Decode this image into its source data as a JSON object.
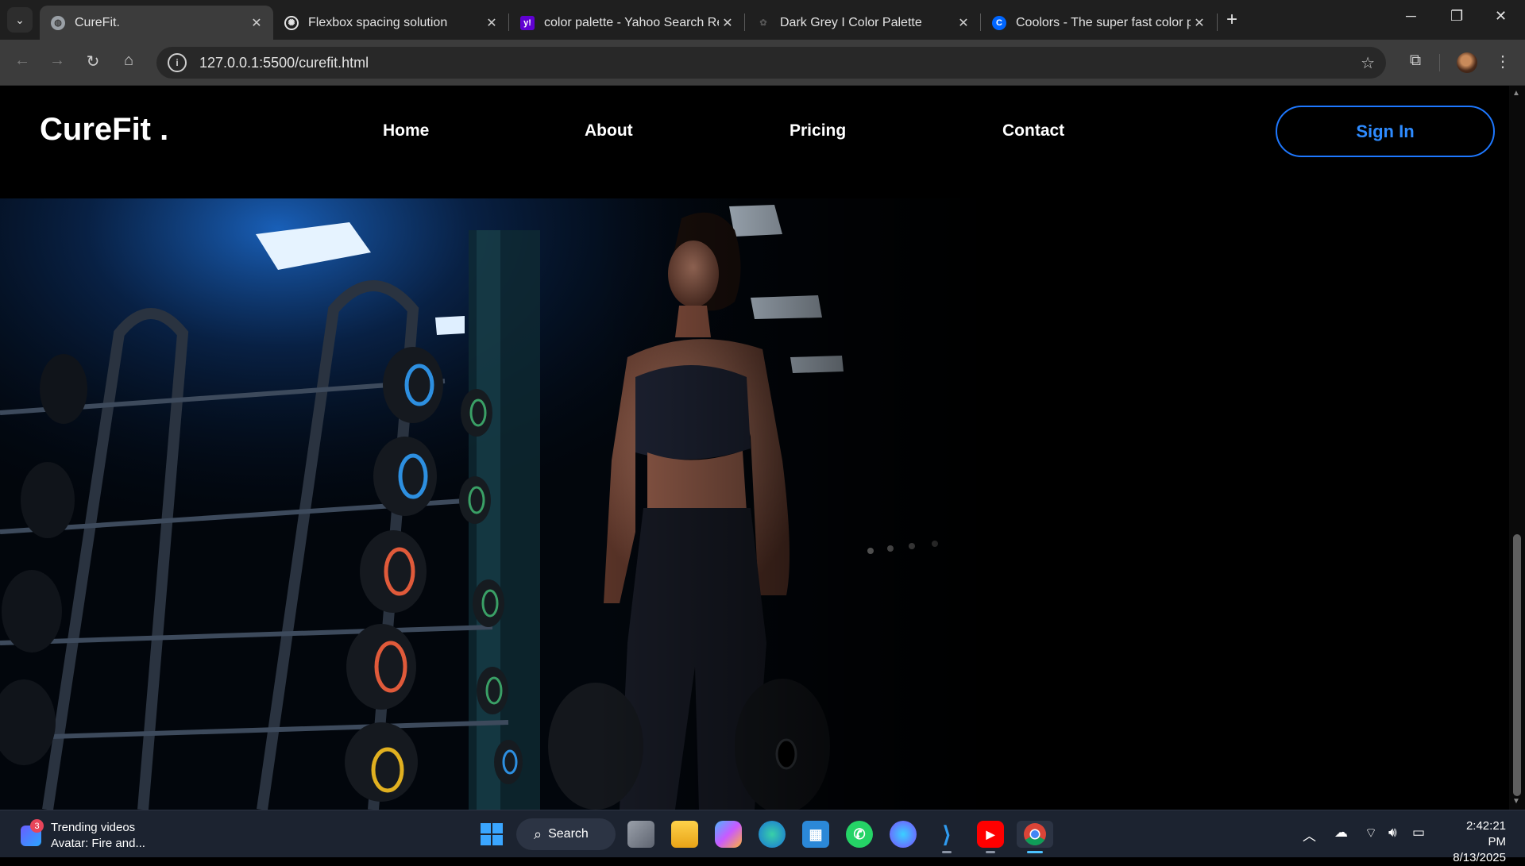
{
  "browser": {
    "tabs": [
      {
        "title": "CureFit.",
        "active": true,
        "icon": "globe-icon"
      },
      {
        "title": "Flexbox spacing solution",
        "active": false,
        "icon": "chatgpt-icon"
      },
      {
        "title": "color palette - Yahoo Search Re",
        "active": false,
        "icon": "yahoo-icon"
      },
      {
        "title": "Dark Grey I Color Palette",
        "active": false,
        "icon": "palette-icon"
      },
      {
        "title": "Coolors - The super fast color p",
        "active": false,
        "icon": "coolors-icon"
      }
    ],
    "url": "127.0.0.1:5500/curefit.html"
  },
  "site": {
    "logo": "CureFit .",
    "nav": [
      "Home",
      "About",
      "Pricing",
      "Contact"
    ],
    "signin_label": "Sign In",
    "accent": "#1e78ff"
  },
  "taskbar": {
    "widget_badge": "3",
    "widget_title": "Trending videos",
    "widget_subtitle": "Avatar: Fire and...",
    "search_label": "Search",
    "time": "2:42:21 PM",
    "date": "8/13/2025",
    "apps": [
      "start-icon",
      "task-view-icon",
      "file-explorer-icon",
      "copilot-icon",
      "edge-icon",
      "store-icon",
      "whatsapp-icon",
      "messenger-icon",
      "vscode-icon",
      "youtube-icon",
      "chrome-icon"
    ]
  }
}
